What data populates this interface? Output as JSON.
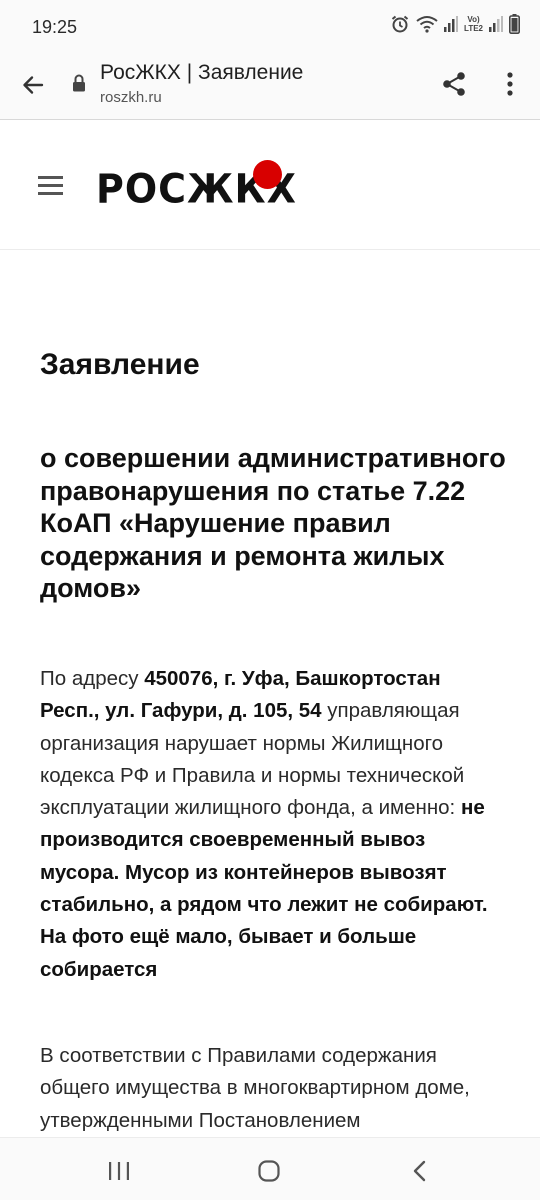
{
  "status_bar": {
    "time": "19:25",
    "network_top": "Vo)",
    "network_bottom": "LTE2"
  },
  "browser": {
    "page_title": "РосЖКХ | Заявление",
    "domain": "roszkh.ru"
  },
  "site": {
    "logo_text": "РОСЖКХ",
    "logo_dot_color": "#d80000"
  },
  "document": {
    "title": "Заявление",
    "subtitle": "о совершении административного правонарушения по статье 7.22 КоАП «Нарушение правил содержания и ремонта жилых домов»",
    "p1_lead": "По адресу ",
    "p1_address": "450076, г. Уфа, Башкортостан Респ., ул. Гафури, д. 105, 54",
    "p1_mid": " управляющая организация нарушает нормы Жилищного кодекса РФ и Правила и нормы технической эксплуатации жилищного фонда, а именно: ",
    "p1_violation": "не производится своевременный вывоз мусора. Мусор из контейнеров вывозят стабильно, а рядом что лежит не собирают. На фото ещё мало, бывает и больше собирается",
    "p2": "В соответствии с Правилами содержания общего имущества в многоквартирном доме, утвержденными Постановлением"
  }
}
